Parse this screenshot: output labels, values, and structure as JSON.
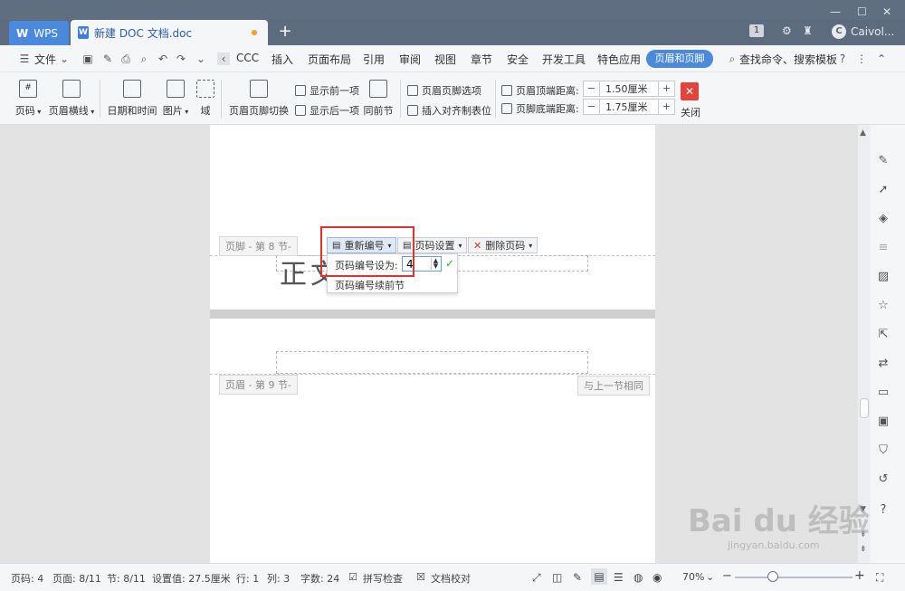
{
  "titlebar": {
    "app_tab": "WPS",
    "doc_tab": "新建 DOC 文档.doc",
    "add_tab": "+",
    "badge": "1",
    "user_initial": "C",
    "user_name": "Caivol..."
  },
  "menubar": {
    "file": "文件",
    "items": [
      "CCC",
      "插入",
      "页面布局",
      "引用",
      "审阅",
      "视图",
      "章节",
      "安全",
      "开发工具",
      "特色应用"
    ],
    "active": "页眉和页脚",
    "search": "查找命令、搜索模板"
  },
  "ribbon": {
    "page_number": "页码",
    "header_line": "页眉横线",
    "date_time": "日期和时间",
    "picture": "图片",
    "field": "域",
    "switch_hf": "页眉页脚切换",
    "show_prev": "显示前一项",
    "show_next": "显示后一项",
    "same_as_prev": "同前节",
    "hf_options": "页眉页脚选项",
    "insert_align_tab": "插入对齐制表位",
    "header_top_label": "页眉顶端距离:",
    "header_top_value": "1.50厘米",
    "footer_bottom_label": "页脚底端距离:",
    "footer_bottom_value": "1.75厘米",
    "close": "关闭"
  },
  "document": {
    "footer_label": "页脚 - 第 8 节-",
    "header_label": "页眉 - 第 9 节-",
    "same_as_prev_tag": "与上一节相同",
    "body_text": "正文",
    "renumber_btn": "重新编号",
    "page_setup_btn": "页码设置",
    "delete_page_btn": "删除页码",
    "set_number_label": "页码编号设为:",
    "set_number_value": "4",
    "continue_prev": "页码编号续前节"
  },
  "statusbar": {
    "page_no": "页码: 4",
    "pages": "页面: 8/11",
    "section": "节: 8/11",
    "setting": "设置值: 27.5厘米",
    "row": "行: 1",
    "col": "列: 3",
    "words": "字数: 24",
    "spell": "拼写检查",
    "proof": "文档校对",
    "zoom": "70%"
  },
  "watermark": {
    "logo": "Bai du 经验",
    "url": "jingyan.baidu.com"
  },
  "colors": {
    "accent": "#4a89dc",
    "titlebar": "#5d6b7e",
    "close_red": "#e0443a",
    "highlight_red": "#dd3333"
  }
}
